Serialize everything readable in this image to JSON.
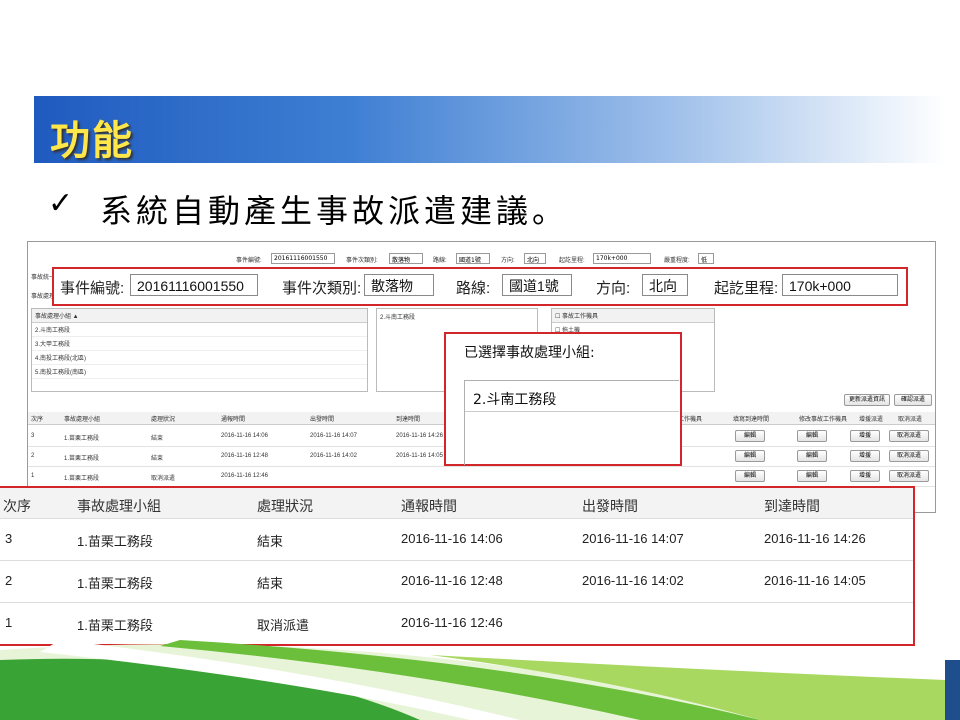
{
  "slide": {
    "title": "功能",
    "bullet_mark": "✓",
    "bullet_text": "系統自動產生事故派遣建議。"
  },
  "screenshot": {
    "top_fields": {
      "event_no_label": "事件編號:",
      "event_no": "20161116001550",
      "subtype_label": "事件次類別:",
      "subtype": "散落物",
      "route_label": "路線:",
      "route": "國道1號",
      "dir_label": "方向:",
      "dir": "北向",
      "mileage_label": "起訖里程:",
      "mileage": "170k+000",
      "severity_label": "嚴重程度:",
      "severity": "低"
    },
    "left_edge_labels": [
      "事故統一",
      "事故處理"
    ],
    "team_list_header": "事故處理小組 ▲",
    "team_list": [
      "2.斗南工務段",
      "3.大甲工務段",
      "4.南投工務段(北區)",
      "5.南投工務段(南區)"
    ],
    "middle_box_item": "2.斗南工務段",
    "agency_header": "事故工作機具",
    "agency_item": "拖土機",
    "btn_refresh": "更新派遣資訊",
    "btn_confirm": "確認派遣",
    "grid_headers": [
      "次序",
      "事故處理小組",
      "處理狀況",
      "通報時間",
      "出發時間",
      "到達時間",
      "工作機具",
      "填寫到達時間",
      "修改事故工作機具",
      "增援派遣",
      "取消派遣"
    ],
    "grid_rows": [
      {
        "seq": "3",
        "team": "1.苗栗工務段",
        "status": "結束",
        "report": "2016-11-16 14:06",
        "depart": "2016-11-16 14:07",
        "arrive": "2016-11-16 14:26"
      },
      {
        "seq": "2",
        "team": "1.苗栗工務段",
        "status": "結束",
        "report": "2016-11-16 12:48",
        "depart": "2016-11-16 14:02",
        "arrive": "2016-11-16 14:05"
      },
      {
        "seq": "1",
        "team": "1.苗栗工務段",
        "status": "取消派遣",
        "report": "2016-11-16 12:46",
        "depart": "",
        "arrive": ""
      }
    ],
    "row_buttons": {
      "edit": "編輯",
      "reinforce": "增援",
      "cancel": "取消派遣"
    }
  },
  "zoom_header": {
    "event_no_label": "事件編號:",
    "event_no": "20161116001550",
    "subtype_label": "事件次類別:",
    "subtype": "散落物",
    "route_label": "路線:",
    "route": "國道1號",
    "dir_label": "方向:",
    "dir": "北向",
    "mileage_label": "起訖里程:",
    "mileage": "170k+000"
  },
  "zoom_selected": {
    "label": "已選擇事故處理小組:",
    "item": "2.斗南工務段"
  },
  "zoom_table": {
    "headers": [
      "次序",
      "事故處理小組",
      "處理狀況",
      "通報時間",
      "出發時間",
      "到達時間"
    ],
    "rows": [
      {
        "seq": "3",
        "team": "1.苗栗工務段",
        "status": "結束",
        "report": "2016-11-16 14:06",
        "depart": "2016-11-16 14:07",
        "arrive": "2016-11-16 14:26"
      },
      {
        "seq": "2",
        "team": "1.苗栗工務段",
        "status": "結束",
        "report": "2016-11-16 12:48",
        "depart": "2016-11-16 14:02",
        "arrive": "2016-11-16 14:05"
      },
      {
        "seq": "1",
        "team": "1.苗栗工務段",
        "status": "取消派遣",
        "report": "2016-11-16 12:46",
        "depart": "",
        "arrive": ""
      }
    ]
  },
  "colors": {
    "callout": "#d3262a",
    "title": "#ffe64a",
    "band": "#1f5bbf",
    "green": "#3aa335"
  }
}
